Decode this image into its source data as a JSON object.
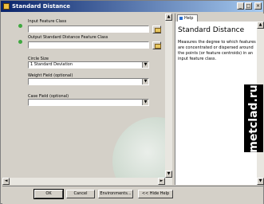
{
  "window": {
    "title": "Standard Distance"
  },
  "form": {
    "input_feature_class_label": "Input Feature Class",
    "output_feature_class_label": "Output Standard Distance Feature Class",
    "circle_size_label": "Circle Size",
    "circle_size_value": "1 Standard Deviation",
    "weight_field_label": "Weight Field (optional)",
    "case_field_label": "Case Field (optional)"
  },
  "buttons": {
    "ok": "OK",
    "cancel": "Cancel",
    "environments": "Environments...",
    "hide_help": "<< Hide Help"
  },
  "help": {
    "tab": "Help",
    "title": "Standard Distance",
    "body": "Measures the degree to which features are concentrated or dispersed around the points (or feature centroids) in an input feature class."
  },
  "watermark": "metclad.ru",
  "colors": {
    "titlebar": "#0a246a",
    "required_dot": "#3fa83f"
  }
}
